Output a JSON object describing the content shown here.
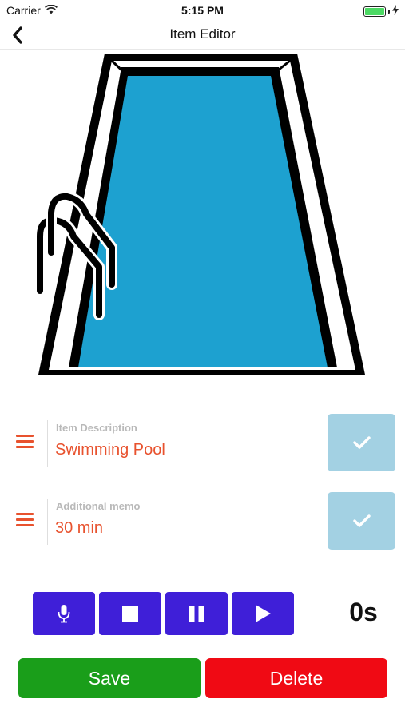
{
  "status_bar": {
    "carrier": "Carrier",
    "time": "5:15 PM",
    "battery_level": 1.0,
    "battery_color": "#4cd964"
  },
  "nav": {
    "back_icon": "chevron-left-icon",
    "title": "Item Editor"
  },
  "image": {
    "subject": "swimming-pool-illustration",
    "water_color": "#1da1d0"
  },
  "fields": [
    {
      "label": "Item Description",
      "value": "Swimming Pool",
      "handle_icon": "hamburger-icon",
      "confirm_icon": "checkmark-icon"
    },
    {
      "label": "Additional memo",
      "value": "30 min",
      "handle_icon": "hamburger-icon",
      "confirm_icon": "checkmark-icon"
    }
  ],
  "recorder": {
    "controls": [
      {
        "name": "record",
        "icon": "microphone-icon"
      },
      {
        "name": "stop",
        "icon": "stop-icon"
      },
      {
        "name": "pause",
        "icon": "pause-icon"
      },
      {
        "name": "play",
        "icon": "play-icon"
      }
    ],
    "elapsed": "0s",
    "button_color": "#3f1fd8"
  },
  "actions": {
    "save_label": "Save",
    "save_color": "#1a9e1a",
    "delete_label": "Delete",
    "delete_color": "#f00a14"
  },
  "colors": {
    "accent": "#e8522e",
    "confirm_button": "#a3d1e3",
    "label_gray": "#b9b9b9"
  }
}
